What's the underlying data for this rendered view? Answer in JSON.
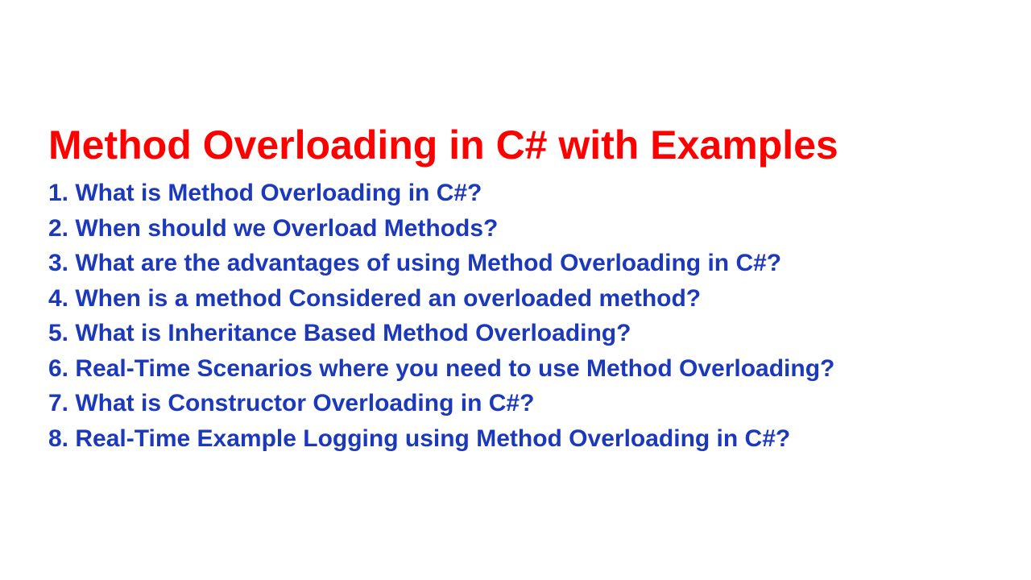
{
  "title": "Method Overloading in C# with Examples",
  "items": [
    "1. What is Method Overloading in C#?",
    "2. When should we Overload Methods?",
    "3. What are the advantages of using Method Overloading in C#?",
    "4. When is a method Considered an overloaded method?",
    "5. What is Inheritance Based Method Overloading?",
    "6. Real-Time Scenarios where you need to use Method Overloading?",
    "7. What is Constructor Overloading in C#?",
    "8. Real-Time Example Logging using Method Overloading in C#?"
  ]
}
